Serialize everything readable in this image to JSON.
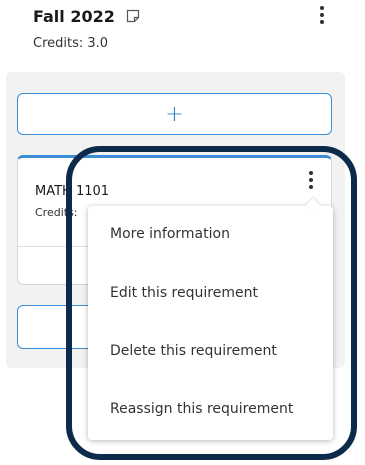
{
  "term": {
    "title": "Fall 2022",
    "credits_label": "Credits:",
    "credits_value": "3.0",
    "note_icon": "note-icon",
    "more_icon": "kebab-menu-icon"
  },
  "add_button": {
    "label": "+"
  },
  "course_card": {
    "name": "MATH 1101",
    "credits_label": "Credits:",
    "more_icon": "kebab-menu-icon"
  },
  "context_menu": {
    "items": [
      {
        "label": "More information"
      },
      {
        "label": "Edit this requirement"
      },
      {
        "label": "Delete this requirement"
      },
      {
        "label": "Reassign this requirement"
      }
    ]
  },
  "colors": {
    "accent": "#3a8ed6",
    "highlight": "#0c2a4a",
    "panel": "#f2f2f2"
  }
}
